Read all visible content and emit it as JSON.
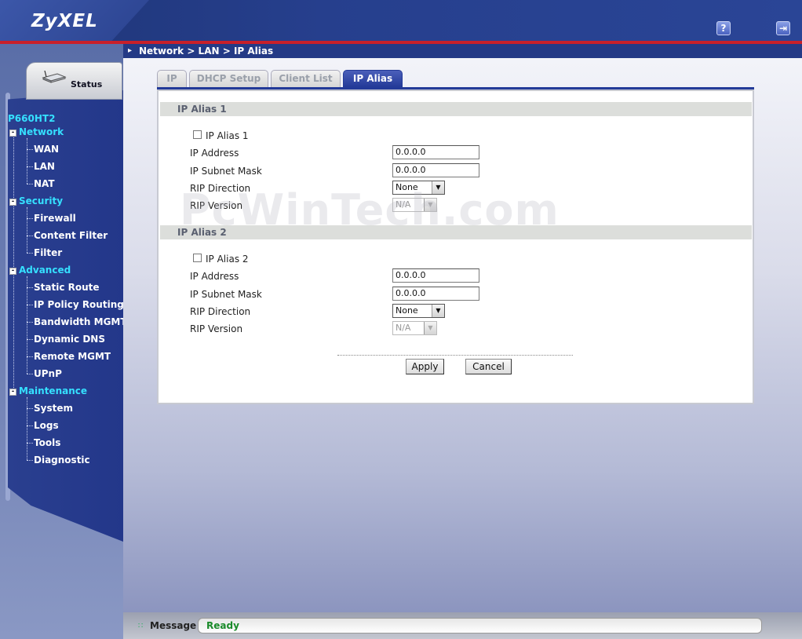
{
  "header": {
    "logo": "ZyXEL",
    "help_icon": "help-icon",
    "logout_icon": "logout-icon"
  },
  "breadcrumb": "Network > LAN > IP Alias",
  "nav": {
    "status": "Status",
    "model": "P660HT2",
    "sections": [
      {
        "label": "Network",
        "items": [
          "WAN",
          "LAN",
          "NAT"
        ]
      },
      {
        "label": "Security",
        "items": [
          "Firewall",
          "Content Filter",
          "Filter"
        ]
      },
      {
        "label": "Advanced",
        "items": [
          "Static Route",
          "IP Policy Routing",
          "Bandwidth MGMT",
          "Dynamic DNS",
          "Remote MGMT",
          "UPnP"
        ]
      },
      {
        "label": "Maintenance",
        "items": [
          "System",
          "Logs",
          "Tools",
          "Diagnostic"
        ]
      }
    ]
  },
  "tabs": [
    "IP",
    "DHCP Setup",
    "Client List",
    "IP Alias"
  ],
  "active_tab": "IP Alias",
  "alias1": {
    "title": "IP Alias 1",
    "checkbox_label": "IP Alias 1",
    "checked": false,
    "ip_label": "IP Address",
    "ip_value": "0.0.0.0",
    "mask_label": "IP Subnet Mask",
    "mask_value": "0.0.0.0",
    "rip_dir_label": "RIP Direction",
    "rip_dir_value": "None",
    "rip_ver_label": "RIP Version",
    "rip_ver_value": "N/A"
  },
  "alias2": {
    "title": "IP Alias 2",
    "checkbox_label": "IP Alias 2",
    "checked": false,
    "ip_label": "IP Address",
    "ip_value": "0.0.0.0",
    "mask_label": "IP Subnet Mask",
    "mask_value": "0.0.0.0",
    "rip_dir_label": "RIP Direction",
    "rip_dir_value": "None",
    "rip_ver_label": "RIP Version",
    "rip_ver_value": "N/A"
  },
  "buttons": {
    "apply": "Apply",
    "cancel": "Cancel"
  },
  "watermark": "PcWinTech.com",
  "footer": {
    "message_label": "Message",
    "message_value": "Ready"
  },
  "colors": {
    "header_blue": "#263f8d",
    "accent_red": "#c8202a",
    "nav_cyan": "#35e0ff",
    "ready_green": "#1a8a2a"
  }
}
